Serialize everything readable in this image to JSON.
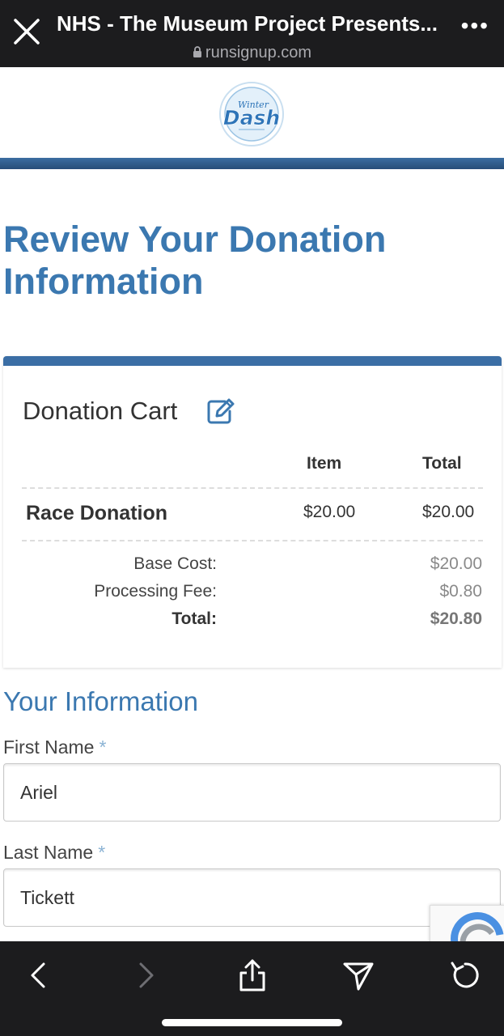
{
  "browser": {
    "page_title": "NHS - The Museum Project Presents...",
    "url": "runsignup.com"
  },
  "header": {
    "logo_top_text": "Winter",
    "logo_main_text": "Dash"
  },
  "main": {
    "heading": "Review Your Donation Information"
  },
  "cart": {
    "title": "Donation Cart",
    "columns": {
      "item": "Item",
      "total": "Total"
    },
    "row": {
      "name": "Race Donation",
      "item": "$20.00",
      "total": "$20.00"
    },
    "summary": {
      "base_cost_label": "Base Cost:",
      "base_cost_value": "$20.00",
      "processing_fee_label": "Processing Fee:",
      "processing_fee_value": "$0.80",
      "total_label": "Total:",
      "total_value": "$20.80"
    }
  },
  "info": {
    "heading": "Your Information",
    "required_marker": "*",
    "first_name": {
      "label": "First Name",
      "value": "Ariel"
    },
    "last_name": {
      "label": "Last Name",
      "value": "Tickett"
    }
  },
  "colors": {
    "accent": "#3b78b0",
    "stripe": "#3b6ea5",
    "toolbar": "#1c1c1e"
  },
  "icons": {
    "close": "close-icon",
    "lock": "lock-icon",
    "more": "more-icon",
    "edit": "edit-icon",
    "back": "back-icon",
    "forward": "forward-icon",
    "share": "share-icon",
    "send": "send-icon",
    "reload": "reload-icon"
  }
}
